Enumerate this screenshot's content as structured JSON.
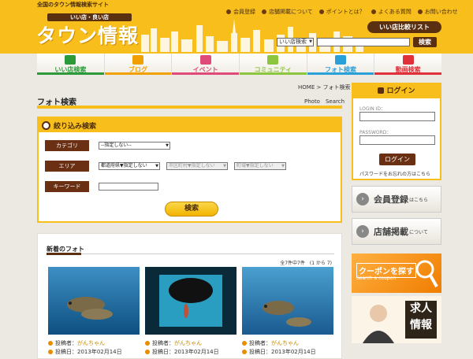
{
  "header": {
    "tagline": "全国のタウン情報検索サイト",
    "subtitle": "いい店・良い店",
    "logo": "タウン情報",
    "toplinks": [
      "会員登録",
      "店舗掲載について",
      "ポイントとは？",
      "よくある質問",
      "お問い合わせ"
    ],
    "compare_label": "いい店比較リスト",
    "search_select": "いい店検索",
    "search_button": "検索"
  },
  "nav": [
    {
      "label": "いい店検索",
      "color": "#2c9a3a"
    },
    {
      "label": "ブログ",
      "color": "#f0a000"
    },
    {
      "label": "イベント",
      "color": "#e04a7a"
    },
    {
      "label": "コミュニティ",
      "color": "#8cc63f"
    },
    {
      "label": "フォト検索",
      "color": "#2aa0d8"
    },
    {
      "label": "動画検索",
      "color": "#e0303a"
    }
  ],
  "breadcrumb": "HOME > フォト検索",
  "page": {
    "title": "フォト検索",
    "title_en": "Photo　Search"
  },
  "search_box": {
    "heading": "絞り込み検索",
    "category_label": "カテゴリ",
    "category_value": "--指定しない--",
    "area_label": "エリア",
    "area_prefecture": "都道府県▼指定しない",
    "area_city": "市区町村▼指定しない",
    "area_town": "町域▼指定しない",
    "keyword_label": "キーワード",
    "submit": "検索"
  },
  "new_photos": {
    "title": "新着のフォト",
    "count": "全7件中7件　(1 から 7)",
    "poster_label": "投稿者：",
    "date_label": "投稿日：",
    "items": [
      {
        "poster": "がんちゃん",
        "date": "2013年02月14日"
      },
      {
        "poster": "がんちゃん",
        "date": "2013年02月14日"
      },
      {
        "poster": "がんちゃん",
        "date": "2013年02月14日"
      }
    ]
  },
  "login": {
    "heading": "ログイン",
    "id_label": "LOGIN ID：",
    "password_label": "PASSWORD：",
    "button": "ログイン",
    "forgot": "パスワードをお忘れの方はこちら"
  },
  "side": {
    "register_big": "会員登録",
    "register_small": "はこちら",
    "listing_big": "店舗掲載",
    "listing_small": "について",
    "coupon_title": "クーポンを探す",
    "coupon_sub": "Search a coupon",
    "job": "求人情報"
  },
  "colors": {
    "accent": "#f8bf1c",
    "brown": "#5a3010"
  }
}
